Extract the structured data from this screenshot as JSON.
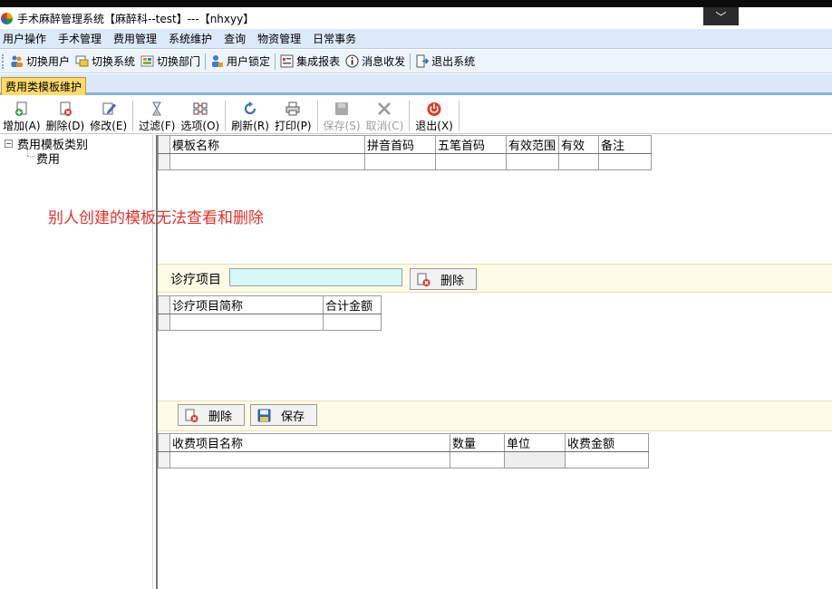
{
  "window": {
    "title": "手术麻醉管理系统【麻醉科--test】---【nhxyy】",
    "caption_glyph": "﹀"
  },
  "menubar": {
    "items": [
      "用户操作",
      "手术管理",
      "费用管理",
      "系统维护",
      "查询",
      "物资管理",
      "日常事务"
    ]
  },
  "quickbar": {
    "items": [
      "切换用户",
      "切换系统",
      "切换部门",
      "用户锁定",
      "集成报表",
      "消息收发",
      "退出系统"
    ]
  },
  "tabs": {
    "active": "费用类模板维护"
  },
  "toolbar": {
    "add": "增加(A)",
    "delete": "删除(D)",
    "edit": "修改(E)",
    "filter": "过滤(F)",
    "options": "选项(O)",
    "refresh": "刷新(R)",
    "print": "打印(P)",
    "save": "保存(S)",
    "cancel": "取消(C)",
    "exit": "退出(X)"
  },
  "tree": {
    "root": "费用模板类别",
    "toggle": "−",
    "child": "费用"
  },
  "notice": "别人创建的模板无法查看和删除",
  "template_grid": {
    "columns": [
      "模板名称",
      "拼音首码",
      "五笔首码",
      "有效范围",
      "有效",
      "备注"
    ]
  },
  "diag_section": {
    "label": "诊疗项目",
    "input_value": "",
    "delete_button": "删除"
  },
  "diag_grid": {
    "columns": [
      "诊疗项目简称",
      "合计金额"
    ]
  },
  "fee_section": {
    "delete_button": "删除",
    "save_button": "保存"
  },
  "fee_grid": {
    "columns": [
      "收费项目名称",
      "数量",
      "单位",
      "收费金额"
    ]
  },
  "colors": {
    "notice": "#e0312d",
    "tab_active": "#ffd96a",
    "menubar": "#dce9f8",
    "input_bg": "#d9f7f7"
  }
}
